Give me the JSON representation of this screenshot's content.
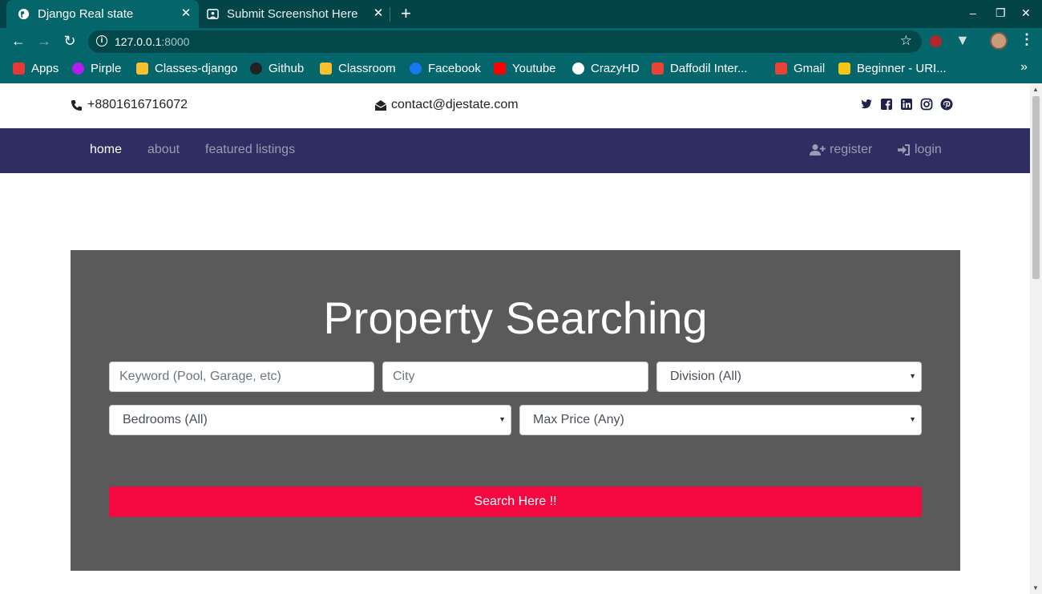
{
  "browser": {
    "tabs": [
      {
        "title": "Django Real state",
        "active": true
      },
      {
        "title": "Submit Screenshot Here",
        "active": false
      }
    ],
    "new_tab_symbol": "+",
    "window_controls": [
      "–",
      "❐",
      "✕"
    ],
    "url_host": "127.0.0.1",
    "url_port": ":8000",
    "bookmarks": [
      {
        "label": "Apps",
        "icon": "apps-grid-icon",
        "color": "#e53935"
      },
      {
        "label": "Pirple",
        "icon": "pirple-icon",
        "color": "#b51cf1"
      },
      {
        "label": "Classes-django",
        "icon": "classroom-icon",
        "color": "#fbc02d"
      },
      {
        "label": "Github",
        "icon": "github-icon",
        "color": "#222222"
      },
      {
        "label": "Classroom",
        "icon": "classroom-icon",
        "color": "#fbc02d"
      },
      {
        "label": "Facebook",
        "icon": "facebook-icon",
        "color": "#1877f2"
      },
      {
        "label": "Youtube",
        "icon": "youtube-icon",
        "color": "#ff0000"
      },
      {
        "label": "CrazyHD",
        "icon": "globe-icon",
        "color": "#ffffff"
      },
      {
        "label": "Daffodil Inter...",
        "icon": "gmail-icon",
        "color": "#ea4335"
      },
      {
        "label": "Gmail",
        "icon": "gmail-icon",
        "color": "#ea4335"
      },
      {
        "label": "Beginner - URI...",
        "icon": "trophy-icon",
        "color": "#f5c518"
      }
    ],
    "more_bookmarks": "»"
  },
  "topbar": {
    "phone": "+8801616716072",
    "email": "contact@djestate.com",
    "social_icons": [
      "twitter-icon",
      "facebook-icon",
      "linkedin-icon",
      "instagram-icon",
      "pinterest-icon"
    ]
  },
  "nav": {
    "home": "home",
    "about": "about",
    "featured": "featured listings",
    "register": "register",
    "login": "login",
    "bg_color": "#2f2e63"
  },
  "hero": {
    "title": "Property Searching",
    "keyword_placeholder": "Keyword (Pool, Garage, etc)",
    "city_placeholder": "City",
    "division_selected": "Division (All)",
    "bedrooms_selected": "Bedrooms (All)",
    "max_price_selected": "Max Price (Any)",
    "search_button": "Search Here !!",
    "button_color": "#f30840"
  }
}
